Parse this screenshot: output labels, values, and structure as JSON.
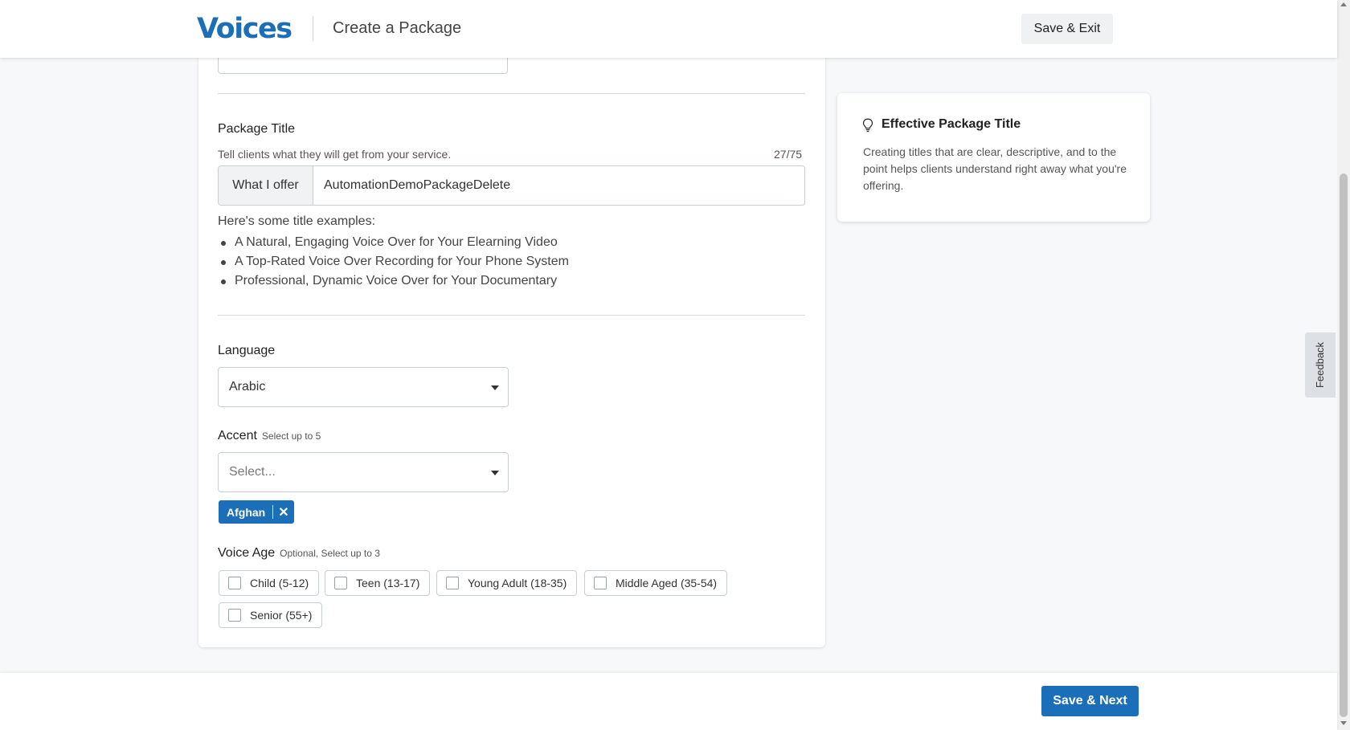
{
  "header": {
    "logo": "Voices",
    "title": "Create a Package",
    "save_exit_label": "Save & Exit"
  },
  "package_title": {
    "label": "Package Title",
    "hint": "Tell clients what they will get from your service.",
    "counter": "27/75",
    "prefix": "What I offer",
    "value": "AutomationDemoPackageDelete",
    "examples_heading": "Here's some title examples:",
    "examples": [
      "A Natural, Engaging Voice Over for Your Elearning Video",
      "A Top-Rated Voice Over Recording for Your Phone System",
      "Professional, Dynamic Voice Over for Your Documentary"
    ]
  },
  "language": {
    "label": "Language",
    "value": "Arabic"
  },
  "accent": {
    "label": "Accent",
    "sublabel": "Select up to 5",
    "placeholder": "Select...",
    "selected": [
      "Afghan"
    ]
  },
  "voice_age": {
    "label": "Voice Age",
    "sublabel": "Optional, Select up to 3",
    "options": [
      "Child (5-12)",
      "Teen (13-17)",
      "Young Adult (18-35)",
      "Middle Aged (35-54)",
      "Senior (55+)"
    ]
  },
  "tip": {
    "title": "Effective Package Title",
    "body": "Creating titles that are clear, descriptive, and to the point helps clients understand right away what you're offering."
  },
  "feedback_label": "Feedback",
  "footer": {
    "save_next_label": "Save & Next"
  },
  "colors": {
    "brand": "#1a6fb8",
    "background": "#f7f8fa"
  }
}
